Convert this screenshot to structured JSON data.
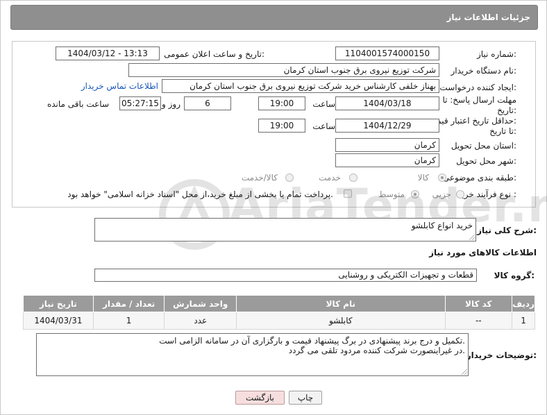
{
  "header": {
    "title": "جزئیات اطلاعات نیاز"
  },
  "fields": {
    "need_number_label": "شماره نیاز:",
    "need_number": "1104001574000150",
    "announce_label": "تاریخ و ساعت اعلان عمومی:",
    "announce_value": "1404/03/12 - 13:13",
    "buyer_org_label": "نام دستگاه خریدار:",
    "buyer_org": "شرکت توزیع نیروی برق جنوب استان کرمان",
    "creator_label": "ایجاد کننده درخواست:",
    "creator": "بهناز خلفی کارشناس خرید شرکت توزیع نیروی برق جنوب استان کرمان",
    "contact_link": "اطلاعات تماس خریدار",
    "deadline_label_1": "مهلت ارسال پاسخ: تا",
    "deadline_label_2": "تاریخ:",
    "deadline_date": "1404/03/18",
    "time_label": "ساعت",
    "deadline_time": "19:00",
    "days_value": "6",
    "days_label": "روز و",
    "remaining_value": "05:27:15",
    "remaining_label": "ساعت باقی مانده",
    "validity_label_1": "حداقل تاریخ اعتبار قیمت:",
    "validity_label_2": "تا تاریخ:",
    "validity_date": "1404/12/29",
    "validity_time_label": "ساعت",
    "validity_time": "19:00",
    "province_label": "استان محل تحویل:",
    "province": "کرمان",
    "city_label": "شهر محل تحویل:",
    "city": "کرمان",
    "category_label": "طبقه بندی موضوعی:",
    "category_options": [
      "کالا",
      "خدمت",
      "کالا/خدمت"
    ],
    "process_label": "نوع فرآیند خرید :",
    "process_options": [
      "جزیی",
      "متوسط"
    ],
    "payment_note": "پرداخت تمام یا بخشی از مبلغ خرید،از محل \"اسناد خزانه اسلامی\" خواهد بود."
  },
  "description": {
    "label": "شرح کلی نیاز:",
    "value": "خرید انواع کابلشو"
  },
  "goods": {
    "section_title": "اطلاعات کالاهای مورد نیاز",
    "group_label": "گروه کالا:",
    "group_value": "قطعات و تجهیزات الکتریکی و روشنایی",
    "table": {
      "headers": [
        "ردیف",
        "کد کالا",
        "نام کالا",
        "واحد شمارش",
        "تعداد / مقدار",
        "تاریخ نیاز"
      ],
      "rows": [
        [
          "1",
          "--",
          "کابلشو",
          "عدد",
          "1",
          "1404/03/31"
        ]
      ]
    }
  },
  "buyer_notes": {
    "label": "توضیحات خریدار:",
    "line1": "تکمیل و درج برند پیشنهادی در برگ پیشنهاد قیمت و بارگزاری آن در سامانه الزامی است.",
    "line2": "در غیراینصورت شرکت کننده مردود تلقی می گردد."
  },
  "buttons": {
    "print": "چاپ",
    "back": "بازگشت"
  },
  "watermark": {
    "text": "AriaTender.neT"
  },
  "colors": {
    "header_bg": "#8f8f8f",
    "table_header_bg": "#9b9b9b",
    "link": "#1a56b8",
    "back_button_bg": "#f7dede"
  }
}
